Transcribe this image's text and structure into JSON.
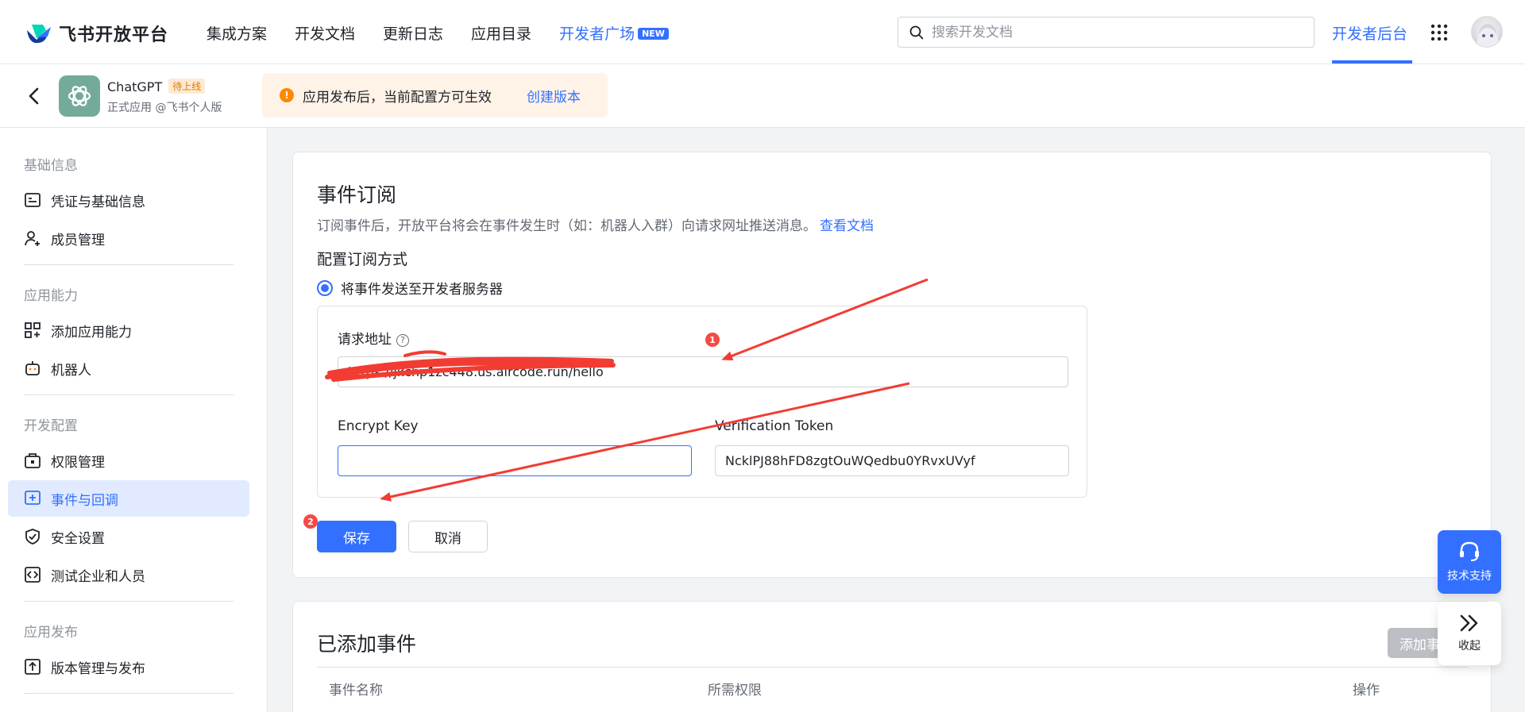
{
  "brand": {
    "name": "飞书开放平台"
  },
  "nav": {
    "links": [
      "集成方案",
      "开发文档",
      "更新日志",
      "应用目录",
      "开发者广场"
    ],
    "new_badge": "NEW",
    "search_placeholder": "搜索开发文档",
    "console": "开发者后台"
  },
  "app": {
    "name": "ChatGPT",
    "status": "待上线",
    "subtitle": "正式应用 @飞书个人版",
    "notice": "应用发布后，当前配置方可生效",
    "notice_link": "创建版本"
  },
  "sidebar": {
    "groups": [
      "基础信息",
      "应用能力",
      "开发配置",
      "应用发布"
    ],
    "items": [
      {
        "label": "凭证与基础信息",
        "icon": "id-card-icon"
      },
      {
        "label": "成员管理",
        "icon": "add-member-icon"
      },
      {
        "label": "添加应用能力",
        "icon": "apps-add-icon"
      },
      {
        "label": "机器人",
        "icon": "robot-icon"
      },
      {
        "label": "权限管理",
        "icon": "lock-briefcase-icon"
      },
      {
        "label": "事件与回调",
        "icon": "event-plus-icon",
        "active": true
      },
      {
        "label": "安全设置",
        "icon": "shield-check-icon"
      },
      {
        "label": "测试企业和人员",
        "icon": "code-box-icon"
      },
      {
        "label": "版本管理与发布",
        "icon": "upload-box-icon"
      }
    ]
  },
  "event_sub": {
    "title": "事件订阅",
    "desc": "订阅事件后，开放平台将会在事件发生时（如：机器人入群）向请求网址推送消息。",
    "doc_link": "查看文档",
    "mode_title": "配置订阅方式",
    "mode_option": "将事件发送至开发者服务器",
    "url_label": "请求地址",
    "url_value": "https://jkchp1zc448.us.aircode.run/hello",
    "encrypt_label": "Encrypt Key",
    "encrypt_value": "",
    "token_label": "Verification Token",
    "token_value": "NcklPJ88hFD8zgtOuWQedbu0YRvxUVyf",
    "save": "保存",
    "cancel": "取消",
    "badge_1": "1",
    "badge_2": "2"
  },
  "added_events": {
    "title": "已添加事件",
    "add_button": "添加事件",
    "columns": [
      "事件名称",
      "所需权限",
      "操作"
    ]
  },
  "float": {
    "support": "技术支持",
    "collapse": "收起"
  },
  "colors": {
    "primary": "#3370ff",
    "annotation_red": "#f23c33",
    "warning": "#ff8800"
  }
}
